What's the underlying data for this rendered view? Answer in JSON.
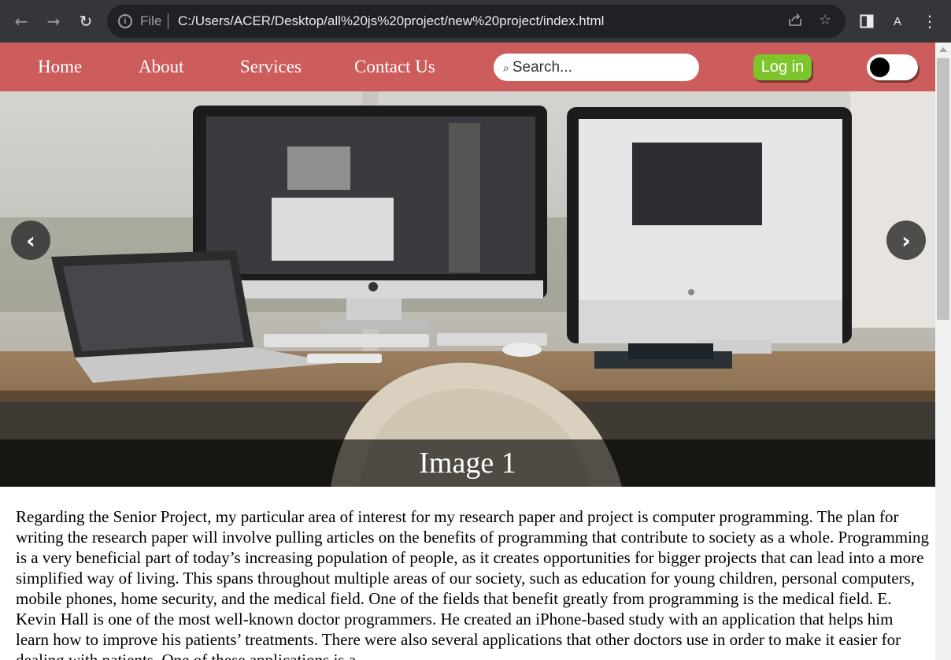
{
  "browser": {
    "file_label": "File",
    "url": "C:/Users/ACER/Desktop/all%20js%20project/new%20project/index.html",
    "profile_initial": "A"
  },
  "nav": {
    "links": [
      "Home",
      "About",
      "Services",
      "Contact Us"
    ],
    "search_placeholder": "Search...",
    "login_label": "Log in",
    "theme_toggle_on": false
  },
  "slideshow": {
    "caption": "Image 1",
    "prev_glyph": "‹",
    "next_glyph": "›"
  },
  "article": {
    "text": "Regarding the Senior Project, my particular area of interest for my research paper and project is computer programming. The plan for writing the research paper will involve pulling articles on the benefits of programming that contribute to society as a whole. Programming is a very beneficial part of today’s increasing population of people, as it creates opportunities for bigger projects that can lead into a more simplified way of living. This spans throughout multiple areas of our society, such as education for young children, personal computers, mobile phones, home security, and the medical field. One of the fields that benefit greatly from programming is the medical field. E. Kevin Hall is one of the most well-known doctor programmers. He created an iPhone-based study with an application that helps him learn how to improve his patients’ treatments. There were also several applications that other doctors use in order to make it easier for dealing with patients. One of these applications is a"
  },
  "colors": {
    "navbar": "#cd5c5c",
    "login_button": "#7cc52a",
    "chrome": "#35363a"
  }
}
